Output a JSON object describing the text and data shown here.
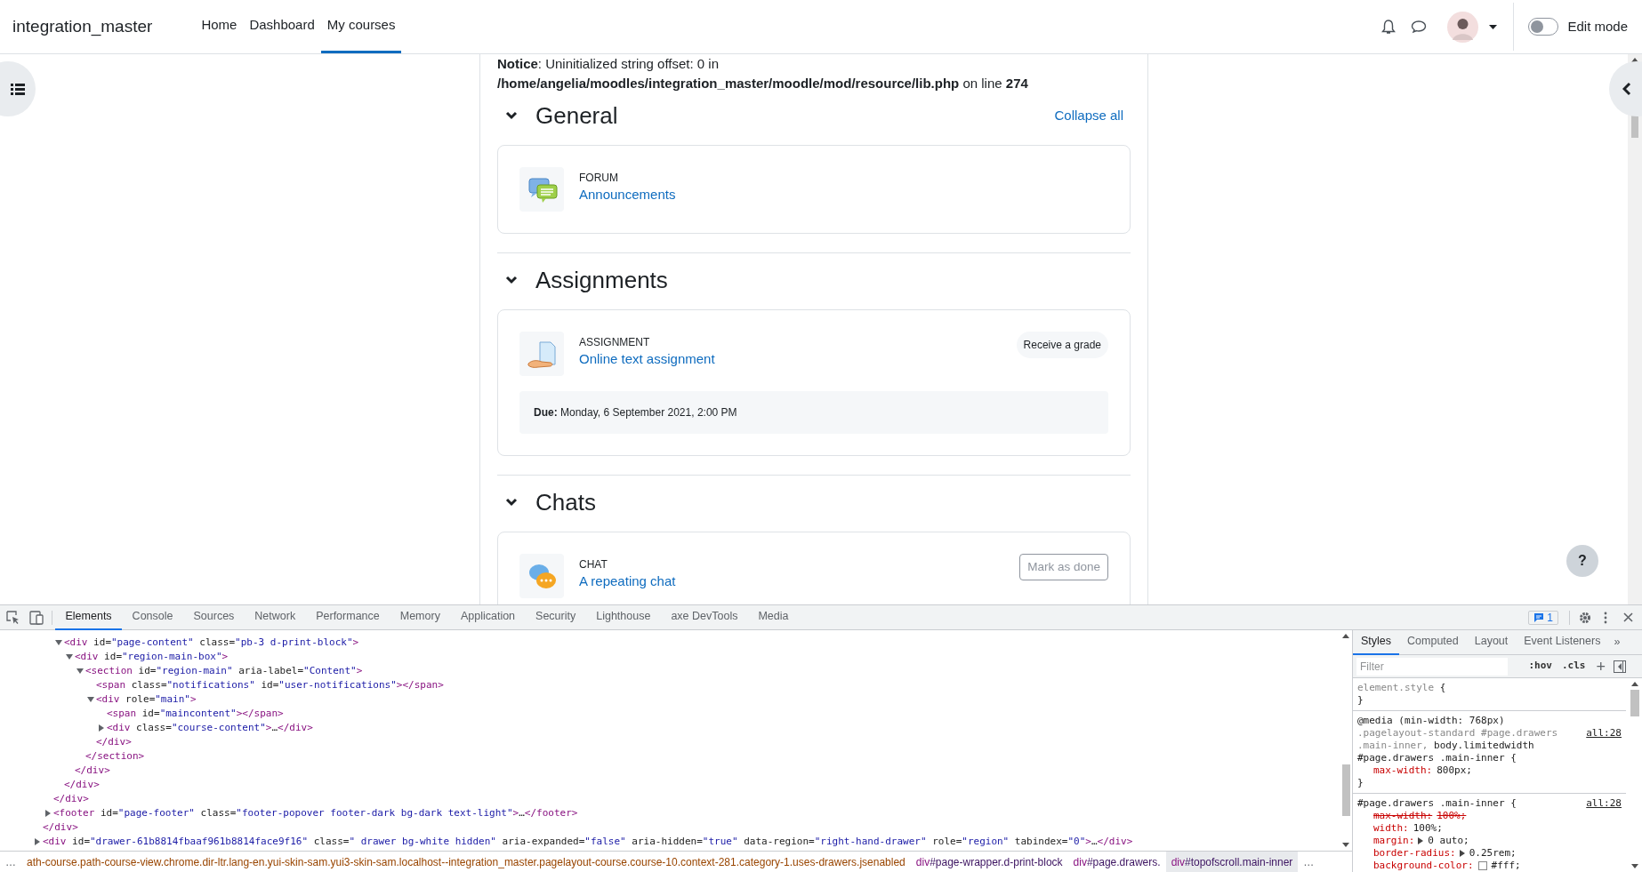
{
  "navbar": {
    "brand": "integration_master",
    "links": [
      {
        "label": "Home",
        "selected": false
      },
      {
        "label": "Dashboard",
        "selected": false
      },
      {
        "label": "My courses",
        "selected": true
      }
    ],
    "edit_mode": {
      "label": "Edit mode",
      "on": false
    }
  },
  "notice": [
    "**Notice**: Uninitialized string offset: 0 in",
    "**/home/angelia/moodles/integration_master/moodle/mod/resource/lib.php** on line **274**"
  ],
  "collapse_all": "Collapse all",
  "sections": [
    {
      "title": "General",
      "expanded": true,
      "activities": [
        {
          "kind": "forum",
          "type_label": "FORUM",
          "name": "Announcements"
        }
      ]
    },
    {
      "title": "Assignments",
      "expanded": true,
      "activities": [
        {
          "kind": "assignment",
          "type_label": "ASSIGNMENT",
          "name": "Online text assignment",
          "badge": "Receive a grade",
          "due": "**Due:** Monday, 6 September 2021, 2:00 PM"
        }
      ]
    },
    {
      "title": "Chats",
      "expanded": true,
      "activities": [
        {
          "kind": "chat",
          "type_label": "CHAT",
          "name": "A repeating chat",
          "button": "Mark as done"
        }
      ]
    }
  ],
  "help_button": "?",
  "devtools": {
    "tabs": [
      {
        "label": "Elements",
        "selected": true
      },
      {
        "label": "Console",
        "selected": false
      },
      {
        "label": "Sources",
        "selected": false
      },
      {
        "label": "Network",
        "selected": false
      },
      {
        "label": "Performance",
        "selected": false
      },
      {
        "label": "Memory",
        "selected": false
      },
      {
        "label": "Application",
        "selected": false
      },
      {
        "label": "Security",
        "selected": false
      },
      {
        "label": "Lighthouse",
        "selected": false
      },
      {
        "label": "axe DevTools",
        "selected": false
      },
      {
        "label": "Media",
        "selected": false
      }
    ],
    "issues_count": "1",
    "dom_tree": [
      {
        "close": "</div>",
        "children": [
          {
            "close": "</div>",
            "children": [
              {
                "open": "<div id=\"page-content\" class=\"pb-3 d-print-block\">",
                "expanded": true,
                "close": "</div>",
                "children": [
                  {
                    "open": "<div id=\"region-main-box\">",
                    "expanded": true,
                    "close": "</div>",
                    "children": [
                      {
                        "open": "<section id=\"region-main\" aria-label=\"Content\">",
                        "expanded": true,
                        "close": "</section>",
                        "children": [
                          {
                            "open": "<span class=\"notifications\" id=\"user-notifications\"></span>"
                          },
                          {
                            "open": "<div role=\"main\">",
                            "expanded": true,
                            "close": "</div>",
                            "children": [
                              {
                                "open": "<span id=\"maincontent\"></span>"
                              },
                              {
                                "open": "<div class=\"course-content\">…</div>",
                                "expanded": false
                              }
                            ]
                          }
                        ]
                      }
                    ]
                  }
                ]
              }
            ]
          },
          {
            "open": "<footer id=\"page-footer\" class=\"footer-popover footer-dark bg-dark text-light\">…</footer>",
            "expanded": false
          }
        ]
      },
      {
        "open": "<div id=\"drawer-61b8814fbaaf961b8814face9f16\" class=\" drawer bg-white hidden\" aria-expanded=\"false\" aria-hidden=\"true\" data-region=\"right-hand-drawer\" role=\"region\" tabindex=\"0\">…</div>",
        "expanded": false
      }
    ],
    "breadcrumbs": [
      {
        "rest": "ath-course.path-course-view.chrome.dir-ltr.lang-en.yui-skin-sam.yui3-skin-sam.localhost--integration_master.pagelayout-course.course-10.context-281.category-1.uses-drawers.jsenabled",
        "selected": false
      },
      {
        "tag": "div",
        "rest": "#page-wrapper.d-print-block",
        "selected": false
      },
      {
        "tag": "div",
        "rest": "#page.drawers.",
        "selected": false
      },
      {
        "tag": "div",
        "rest": "#topofscroll.main-inner",
        "selected": true
      }
    ],
    "breadcrumb_more": "…",
    "breadcrumb_start": "…",
    "styles_tabs": [
      {
        "label": "Styles",
        "selected": true
      },
      {
        "label": "Computed",
        "selected": false
      },
      {
        "label": "Layout",
        "selected": false
      },
      {
        "label": "Event Listeners",
        "selected": false
      }
    ],
    "styles_more": "»",
    "filter": {
      "placeholder": "Filter"
    },
    "hov": ":hov",
    "cls": ".cls",
    "add": "+",
    "rules": [
      {
        "selectors": [
          {
            "text": "element.style",
            "matched": false
          }
        ],
        "open": "{",
        "close": "}"
      },
      {
        "media": "@media (min-width: 768px)",
        "selectors": [
          {
            "text": ".pagelayout-standard #page.drawers",
            "matched": false
          },
          {
            "text": ".main-inner,",
            "matched": false
          },
          {
            "text": "body.limitedwidth",
            "matched": true
          },
          {
            "text": "#page.drawers .main-inner",
            "matched": true
          }
        ],
        "open": "{",
        "close": "}",
        "source": "all:28",
        "props": [
          {
            "kind": "plain",
            "name": "max-width:",
            "value": "800px;",
            "overridden": false
          }
        ]
      },
      {
        "selectors": [
          {
            "text": "#page.drawers .main-inner",
            "matched": true
          }
        ],
        "open": "{",
        "source": "all:28",
        "props": [
          {
            "kind": "plain",
            "name": "max-width:",
            "value": "100%;",
            "overridden": true
          },
          {
            "kind": "plain",
            "name": "width:",
            "value": "100%;",
            "overridden": false
          },
          {
            "kind": "shorthand",
            "name": "margin:",
            "value": "0 auto;",
            "overridden": false
          },
          {
            "kind": "shorthand",
            "name": "border-radius:",
            "value": "0.25rem;",
            "overridden": false
          },
          {
            "kind": "color",
            "name": "background-color:",
            "value": "#fff;",
            "overridden": false
          }
        ]
      }
    ]
  }
}
